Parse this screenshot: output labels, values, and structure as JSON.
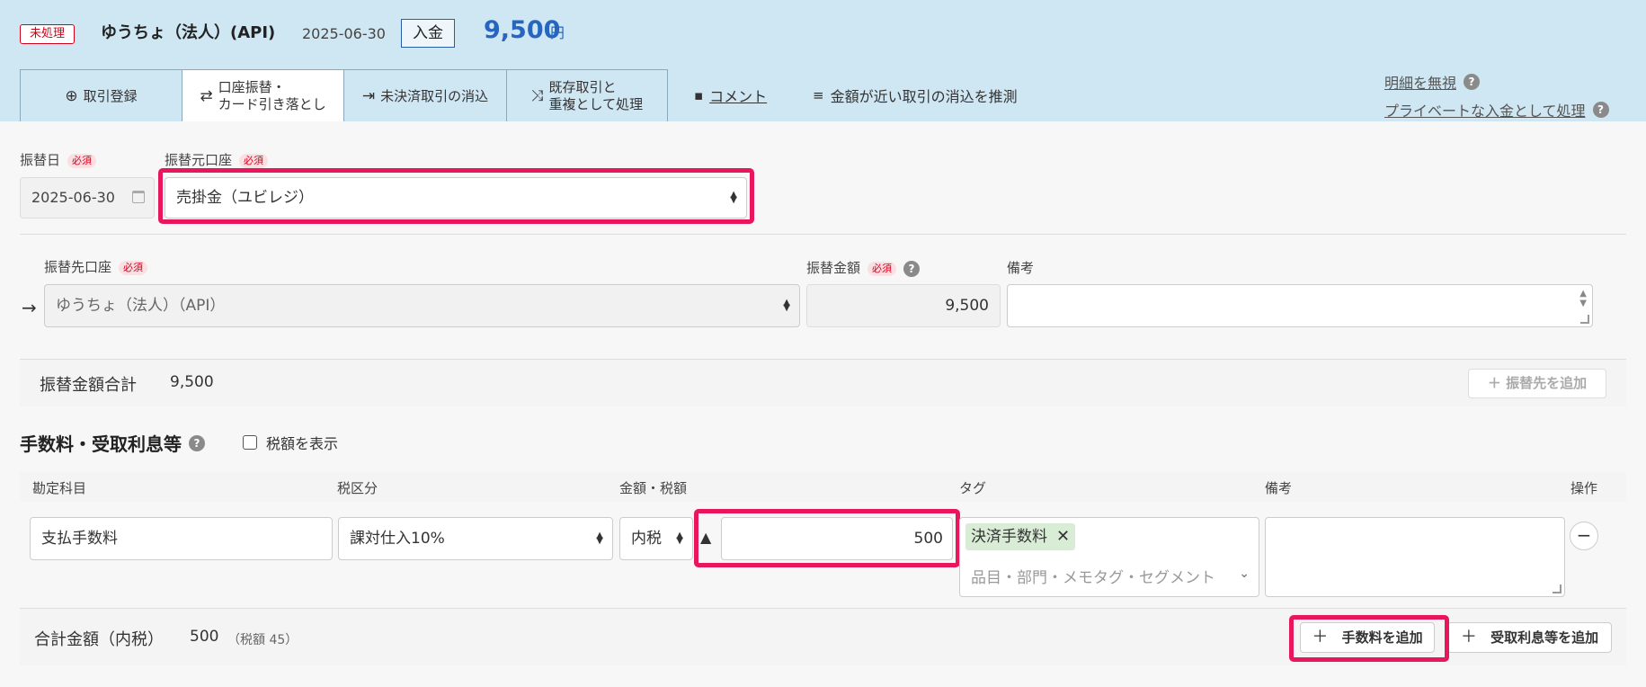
{
  "header": {
    "status": "未処理",
    "account": "ゆうちょ（法人）(API)",
    "date": "2025-06-30",
    "type": "入金",
    "amount": "9,500",
    "unit": "円"
  },
  "tabs": [
    {
      "label": "取引登録",
      "icon": "plus-circle-icon"
    },
    {
      "label_line1": "口座振替・",
      "label_line2": "カード引き落とし",
      "icon": "swap-icon",
      "active": true
    },
    {
      "label": "未決済取引の消込",
      "icon": "merge-icon"
    },
    {
      "label_line1": "既存取引と",
      "label_line2": "重複として処理",
      "icon": "shuffle-icon"
    }
  ],
  "links": {
    "comment": "コメント",
    "suggest": "金額が近い取引の消込を推測",
    "ignore": "明細を無視",
    "private": "プライベートな入金として処理"
  },
  "transfer": {
    "date_label": "振替日",
    "required": "必須",
    "date_value": "2025-06-30",
    "from_label": "振替元口座",
    "from_value": "売掛金（ユビレジ）",
    "to_label": "振替先口座",
    "to_value": "ゆうちょ（法人）（API）",
    "amount_label": "振替金額",
    "amount_value": "9,500",
    "note_label": "備考",
    "total_label": "振替金額合計",
    "total_value": "9,500",
    "add_dest": "振替先を追加"
  },
  "fees": {
    "title": "手数料・受取利息等",
    "show_tax": "税額を表示",
    "columns": [
      "勘定科目",
      "税区分",
      "金額・税額",
      "タグ",
      "備考",
      "操作"
    ],
    "row": {
      "account": "支払手数料",
      "tax_class": "課対仕入10%",
      "tax_mode": "内税",
      "amount": "500",
      "tag": "決済手数料",
      "tag_placeholder": "品目・部門・メモタグ・セグメント"
    },
    "total_label": "合計金額（内税）",
    "total_value": "500",
    "total_tax": "（税額 45）",
    "add_fee": "手数料を追加",
    "add_interest": "受取利息等を追加"
  },
  "colors": {
    "header_bg": "#cfe6f3",
    "accent_blue": "#2766c0",
    "status_red": "#d0021b",
    "highlight": "#e8175d",
    "tag_bg": "#d9ecd6"
  }
}
